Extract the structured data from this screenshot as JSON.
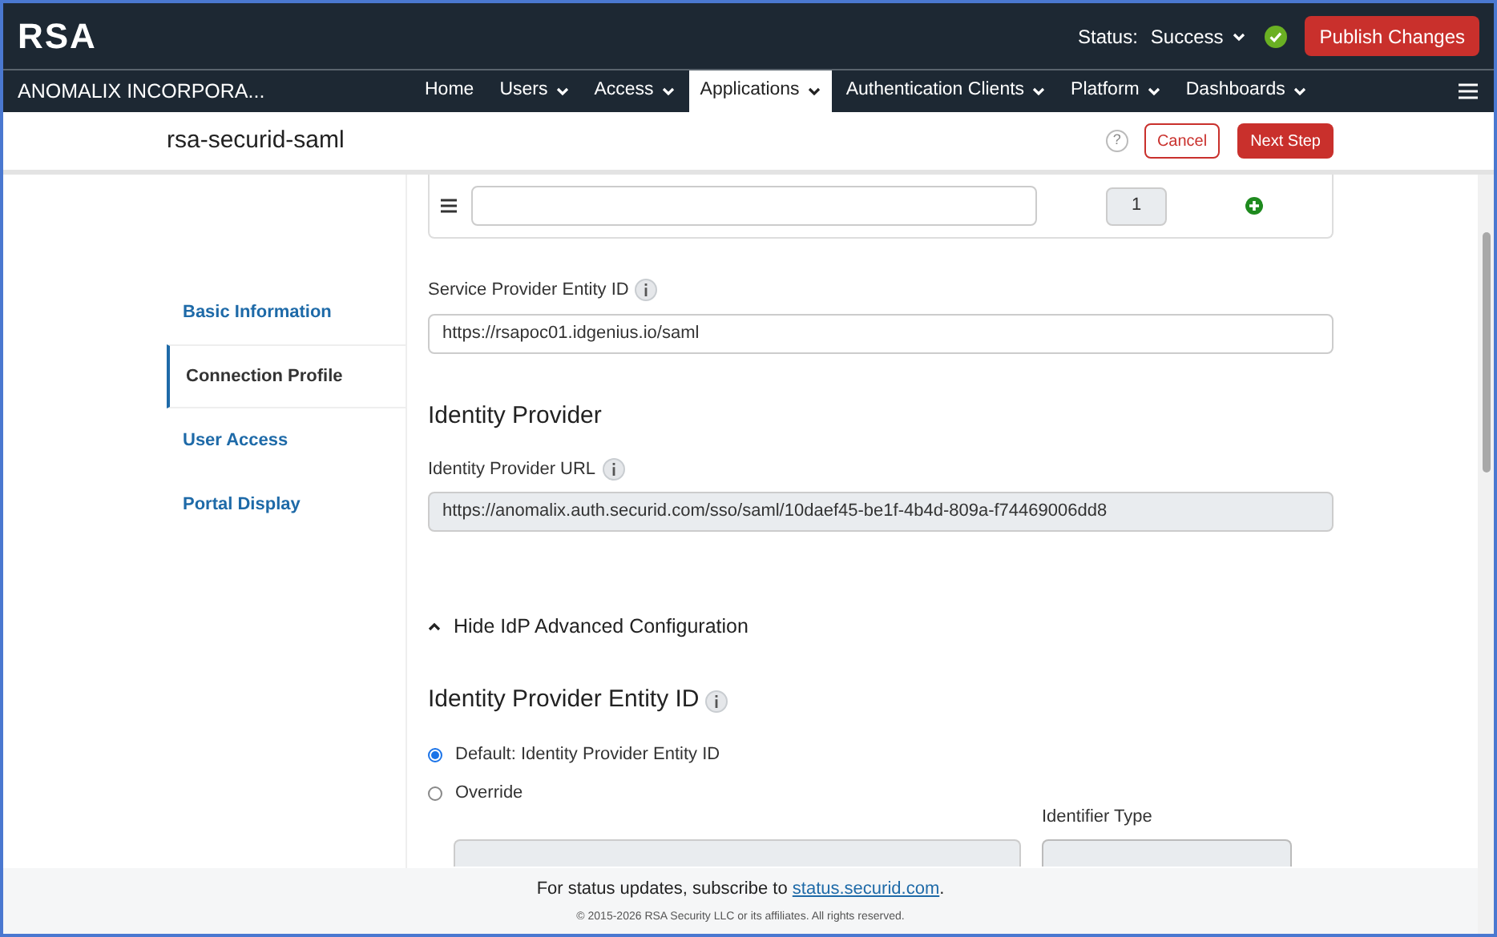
{
  "header": {
    "logo": "RSA",
    "status_label": "Status:",
    "status_value": "Success",
    "publish_button": "Publish Changes"
  },
  "nav": {
    "org": "ANOMALIX INCORPORA...",
    "items": [
      {
        "label": "Home",
        "dropdown": false,
        "selected": false
      },
      {
        "label": "Users",
        "dropdown": true,
        "selected": false
      },
      {
        "label": "Access",
        "dropdown": true,
        "selected": false
      },
      {
        "label": "Applications",
        "dropdown": true,
        "selected": true
      },
      {
        "label": "Authentication Clients",
        "dropdown": true,
        "selected": false
      },
      {
        "label": "Platform",
        "dropdown": true,
        "selected": false
      },
      {
        "label": "Dashboards",
        "dropdown": true,
        "selected": false
      }
    ]
  },
  "page": {
    "title": "rsa-securid-saml",
    "help": "?",
    "cancel": "Cancel",
    "next": "Next Step"
  },
  "sidebar": {
    "items": [
      {
        "label": "Basic Information",
        "selected": false
      },
      {
        "label": "Connection Profile",
        "selected": true
      },
      {
        "label": "User Access",
        "selected": false
      },
      {
        "label": "Portal Display",
        "selected": false
      }
    ]
  },
  "list_row": {
    "value_number": "1"
  },
  "sp_entity": {
    "label": "Service Provider Entity ID",
    "value": "https://rsapoc01.idgenius.io/saml"
  },
  "idp": {
    "heading": "Identity Provider",
    "url_label": "Identity Provider URL",
    "url_value": "https://anomalix.auth.securid.com/sso/saml/10daef45-be1f-4b4d-809a-f74469006dd8"
  },
  "advanced": {
    "toggle": "Hide IdP Advanced Configuration",
    "expanded": true
  },
  "entity_id": {
    "heading": "Identity Provider Entity ID",
    "options": [
      {
        "label": "Default: Identity Provider Entity ID",
        "selected": true
      },
      {
        "label": "Override",
        "selected": false
      }
    ],
    "identifier_type_label": "Identifier Type"
  },
  "footer": {
    "text": "For status updates, subscribe to",
    "link": "status.securid.com",
    "after": ".",
    "copyright": "© 2015-2026 RSA Security LLC or its affiliates. All rights reserved."
  }
}
